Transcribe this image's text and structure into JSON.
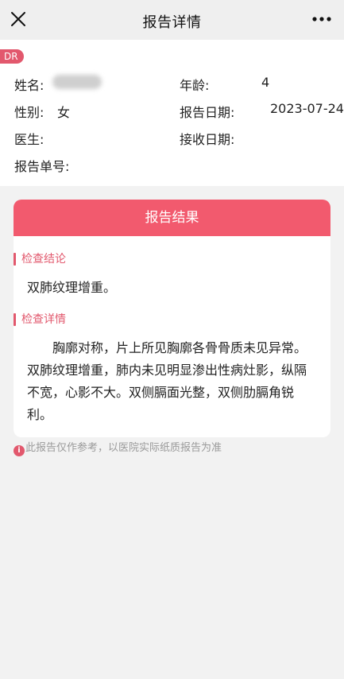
{
  "header": {
    "title": "报告详情"
  },
  "icons": {
    "close": "close-icon",
    "more": "more-icon",
    "info": "info-icon"
  },
  "patient": {
    "badge": "DR",
    "name_label": "姓名:",
    "age_label": "年龄:",
    "age_value": "4",
    "gender_label": "性别:",
    "gender_value": "女",
    "report_date_label": "报告日期:",
    "report_date_value": "2023-07-24",
    "doctor_label": "医生:",
    "receive_date_label": "接收日期:",
    "report_no_label": "报告单号:"
  },
  "result": {
    "title": "报告结果",
    "conclusion_label": "检查结论",
    "conclusion_text": "双肺纹理增重。",
    "detail_label": "检查详情",
    "detail_text": "胸廓对称，片上所见胸廓各骨骨质未见异常。双肺纹理增重，肺内未见明显渗出性病灶影，纵隔不宽，心影不大。双侧膈面光整，双侧肋膈角锐利。"
  },
  "disclaimer": "此报告仅作参考，以医院实际纸质报告为准",
  "colors": {
    "accent": "#f25a6e",
    "badge": "#e2586d",
    "background": "#f2f2f2"
  }
}
